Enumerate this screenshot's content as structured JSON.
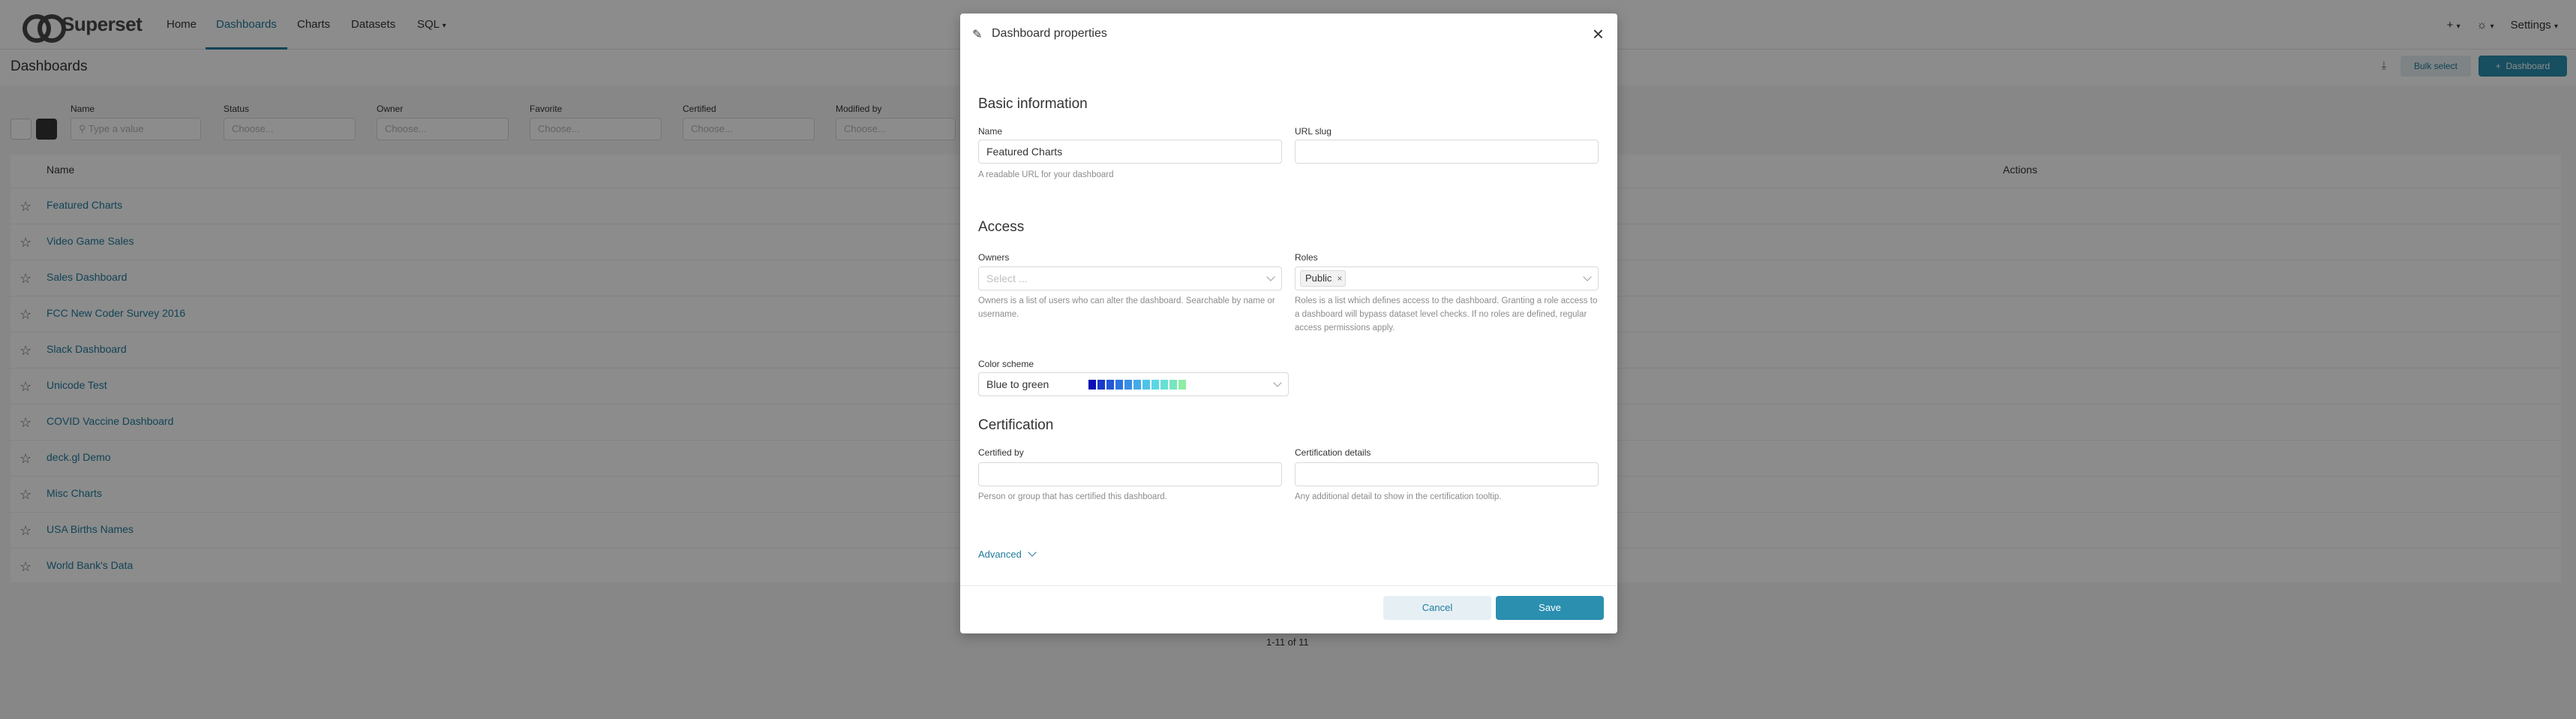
{
  "app": {
    "brand": "Superset",
    "nav": [
      "Home",
      "Dashboards",
      "Charts",
      "Datasets",
      "SQL"
    ],
    "active_nav": "Dashboards",
    "nav_right": {
      "plus": "+",
      "theme": "☼",
      "settings": "Settings"
    },
    "page_title": "Dashboards",
    "header_buttons": {
      "bulk_select": "Bulk select",
      "add_dashboard": "Dashboard"
    },
    "filters": [
      {
        "label": "Name",
        "placeholder": "Type a value"
      },
      {
        "label": "Status",
        "placeholder": "Choose..."
      },
      {
        "label": "Owner",
        "placeholder": "Choose..."
      },
      {
        "label": "Favorite",
        "placeholder": "Choose..."
      },
      {
        "label": "Certified",
        "placeholder": "Choose..."
      },
      {
        "label": "Modified by",
        "placeholder": "Choose..."
      }
    ],
    "table": {
      "headers": {
        "name": "Name",
        "actions": "Actions"
      },
      "rows": [
        "Featured Charts",
        "Video Game Sales",
        "Sales Dashboard",
        "FCC New Coder Survey 2016",
        "Slack Dashboard",
        "Unicode Test",
        "COVID Vaccine Dashboard",
        "deck.gl Demo",
        "Misc Charts",
        "USA Births Names",
        "World Bank's Data"
      ]
    },
    "pagination": "1-11 of 11"
  },
  "modal": {
    "title": "Dashboard properties",
    "basic": {
      "heading": "Basic information",
      "name_label": "Name",
      "name_value": "Featured Charts",
      "name_help": "A readable URL for your dashboard",
      "slug_label": "URL slug",
      "slug_value": ""
    },
    "access": {
      "heading": "Access",
      "owners_label": "Owners",
      "owners_placeholder": "Select ...",
      "owners_help": "Owners is a list of users who can alter the dashboard. Searchable by name or username.",
      "roles_label": "Roles",
      "roles_tag": "Public",
      "roles_help": "Roles is a list which defines access to the dashboard. Granting a role access to a dashboard will bypass dataset level checks. If no roles are defined, regular access permissions apply.",
      "color_label": "Color scheme",
      "color_value": "Blue to green",
      "color_swatches": [
        "#0a0fb5",
        "#1a3bc9",
        "#2557d6",
        "#2f74de",
        "#3a8fe3",
        "#44aae6",
        "#4fc3e8",
        "#5ad7e4",
        "#66e0d4",
        "#74e6c0",
        "#8eeca4"
      ]
    },
    "certification": {
      "heading": "Certification",
      "by_label": "Certified by",
      "by_value": "",
      "by_help": "Person or group that has certified this dashboard.",
      "details_label": "Certification details",
      "details_value": "",
      "details_help": "Any additional detail to show in the certification tooltip."
    },
    "advanced": "Advanced",
    "cancel": "Cancel",
    "save": "Save"
  }
}
